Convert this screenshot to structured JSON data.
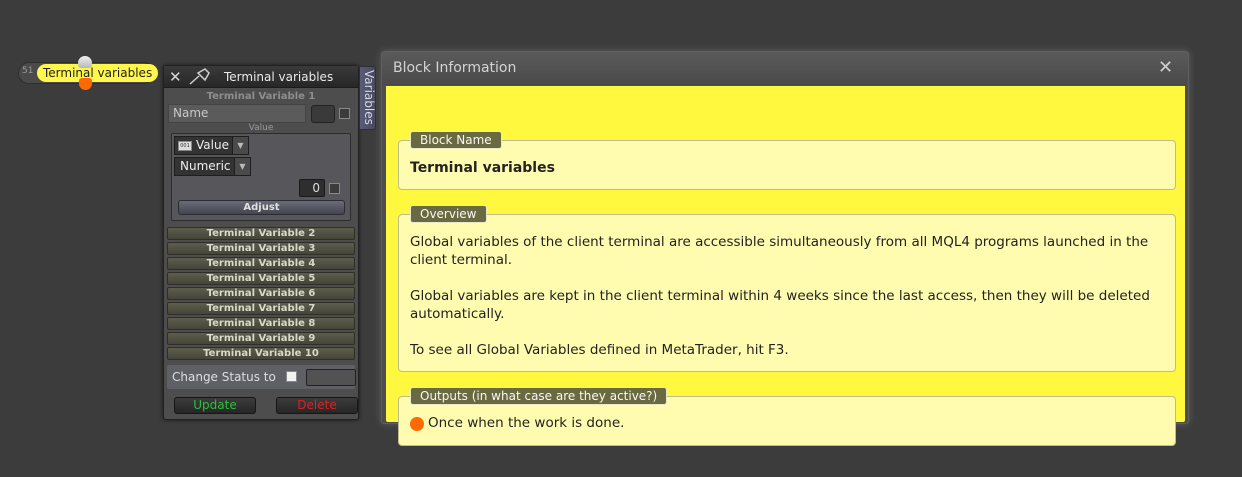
{
  "node": {
    "id": "51",
    "title": "Terminal variables"
  },
  "tv_panel": {
    "title": "Terminal variables",
    "subtitle": "Terminal Variable 1",
    "name_placeholder": "Name",
    "value_caption": "Value",
    "type_icon_text": "001",
    "type_label": "Value",
    "numeric_label": "Numeric",
    "value": "0",
    "adjust_label": "Adjust",
    "variables": [
      "Terminal Variable 2",
      "Terminal Variable 3",
      "Terminal Variable 4",
      "Terminal Variable 5",
      "Terminal Variable 6",
      "Terminal Variable 7",
      "Terminal Variable 8",
      "Terminal Variable 9",
      "Terminal Variable 10"
    ],
    "status_label": "Change Status to",
    "update_label": "Update",
    "delete_label": "Delete",
    "side_tab": "Variables"
  },
  "info": {
    "title": "Block Information",
    "block_name_label": "Block Name",
    "block_name": "Terminal variables",
    "overview_label": "Overview",
    "overview": [
      "Global variables of the client terminal are accessible simultaneously from all MQL4 programs launched in the client terminal.",
      "Global variables are kept in the client terminal within 4 weeks since the last access, then they will be deleted automatically.",
      "To see all Global Variables defined in MetaTrader, hit F3."
    ],
    "outputs_label": "Outputs (in what case are they active?)",
    "output_text": "Once when the work is done."
  },
  "colors": {
    "accent_yellow": "#fff83e",
    "output_orange": "#ff6a00",
    "update_green": "#29c23a",
    "delete_red": "#e02020"
  }
}
